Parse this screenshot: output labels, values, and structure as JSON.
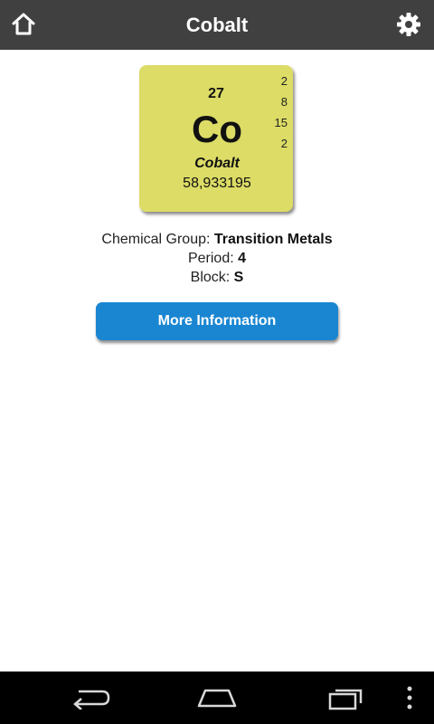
{
  "header": {
    "title": "Cobalt"
  },
  "element": {
    "atomic_number": "27",
    "symbol": "Co",
    "name": "Cobalt",
    "atomic_mass": "58,933195",
    "shells": [
      "2",
      "8",
      "15",
      "2"
    ],
    "tile_color": "#dcdc66"
  },
  "info": {
    "group_label": "Chemical Group: ",
    "group_value": "Transition Metals",
    "period_label": "Period: ",
    "period_value": "4",
    "block_label": "Block: ",
    "block_value": "S"
  },
  "actions": {
    "more_info_label": "More Information",
    "button_color": "#1a86d2"
  },
  "icons": {
    "home": "home-icon",
    "settings": "gear-icon",
    "back": "back-icon",
    "home_nav": "home-nav-icon",
    "recents": "recent-apps-icon",
    "menu": "overflow-menu-icon"
  }
}
